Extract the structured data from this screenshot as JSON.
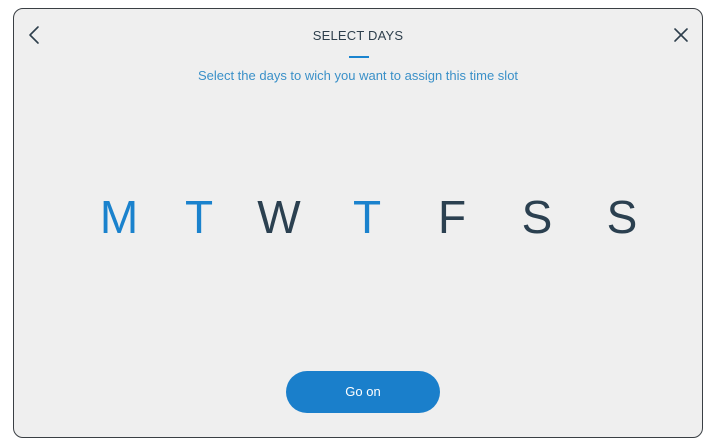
{
  "header": {
    "title": "SELECT DAYS",
    "subtitle": "Select the days to wich you want to assign this time slot",
    "back_icon": "chevron-left-icon",
    "close_icon": "close-icon"
  },
  "days": [
    {
      "label": "M",
      "selected": true
    },
    {
      "label": "T",
      "selected": true
    },
    {
      "label": "W",
      "selected": false
    },
    {
      "label": "T",
      "selected": true
    },
    {
      "label": "F",
      "selected": false
    },
    {
      "label": "S",
      "selected": false
    },
    {
      "label": "S",
      "selected": false
    }
  ],
  "actions": {
    "go_on_label": "Go on"
  },
  "colors": {
    "selected": "#1a82cd",
    "unselected": "#2b4050",
    "button": "#1a7fcb"
  }
}
